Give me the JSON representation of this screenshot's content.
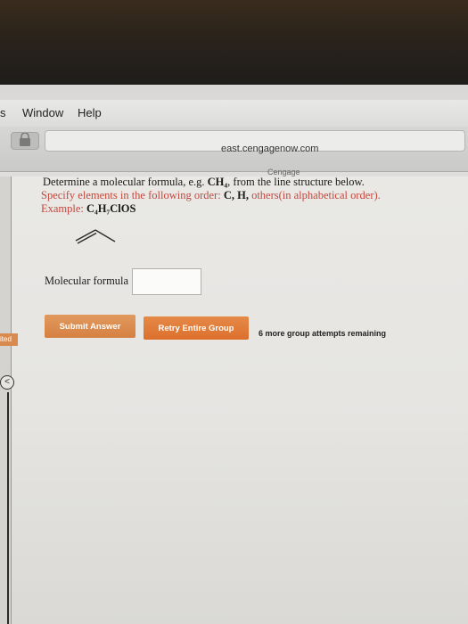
{
  "menubar": {
    "items": [
      "s",
      "Window",
      "Help"
    ]
  },
  "browser": {
    "url": "east.cengagenow.com",
    "tab_title": "Cengage"
  },
  "sidebar": {
    "visited_label": "ited",
    "back_glyph": "<"
  },
  "question": {
    "line1_prefix": "Determine a molecular formula, e.g. ",
    "line1_formula": "CH₄",
    "line1_suffix": ", from the line structure below.",
    "line2_prefix": "Specify elements in the following order: ",
    "line2_elements": "C, H,",
    "line2_suffix": " others(in alphabetical order).",
    "line3_prefix": "Example: ",
    "line3_formula": "C₄H₇ClOS"
  },
  "form": {
    "label": "Molecular formula",
    "value": "",
    "submit_label": "Submit Answer",
    "retry_label": "Retry Entire Group",
    "attempts_text": "6 more group attempts remaining"
  },
  "colors": {
    "instruction_red": "#c4483d",
    "button_orange": "#d67f42",
    "button_orange_bright": "#dd6f2c"
  }
}
